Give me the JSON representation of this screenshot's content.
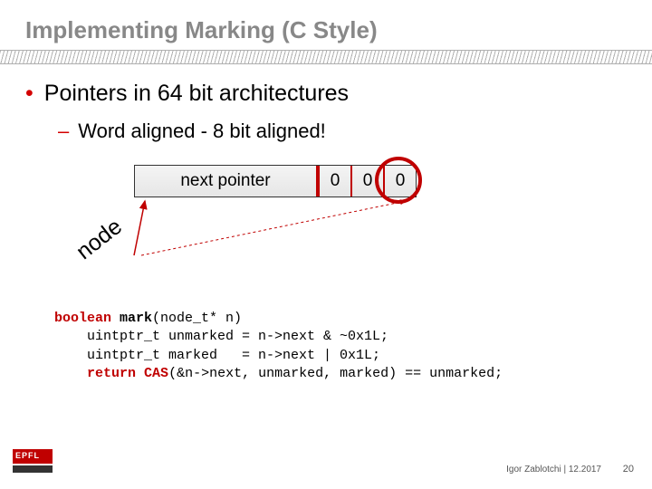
{
  "title": "Implementing Marking (C Style)",
  "bullet": "Pointers in 64 bit architectures",
  "sub": "Word aligned - 8 bit aligned!",
  "diagram": {
    "pointer_label": "next pointer",
    "bits": [
      "0",
      "0",
      "0"
    ],
    "node_label": "node"
  },
  "code": {
    "l1a": "boolean",
    "l1b": " ",
    "l1c": "mark",
    "l1d": "(node_t* n)",
    "l2": "    uintptr_t unmarked = n->next & ~0x1L;",
    "l3": "    uintptr_t marked   = n->next | 0x1L;",
    "l4a": "    ",
    "l4b": "return",
    "l4c": " ",
    "l4d": "CAS",
    "l4e": "(&n->next, unmarked, marked) == unmarked;"
  },
  "footer": "Igor Zablotchi | 12.2017",
  "page": "20",
  "logo_text": "EPFL"
}
